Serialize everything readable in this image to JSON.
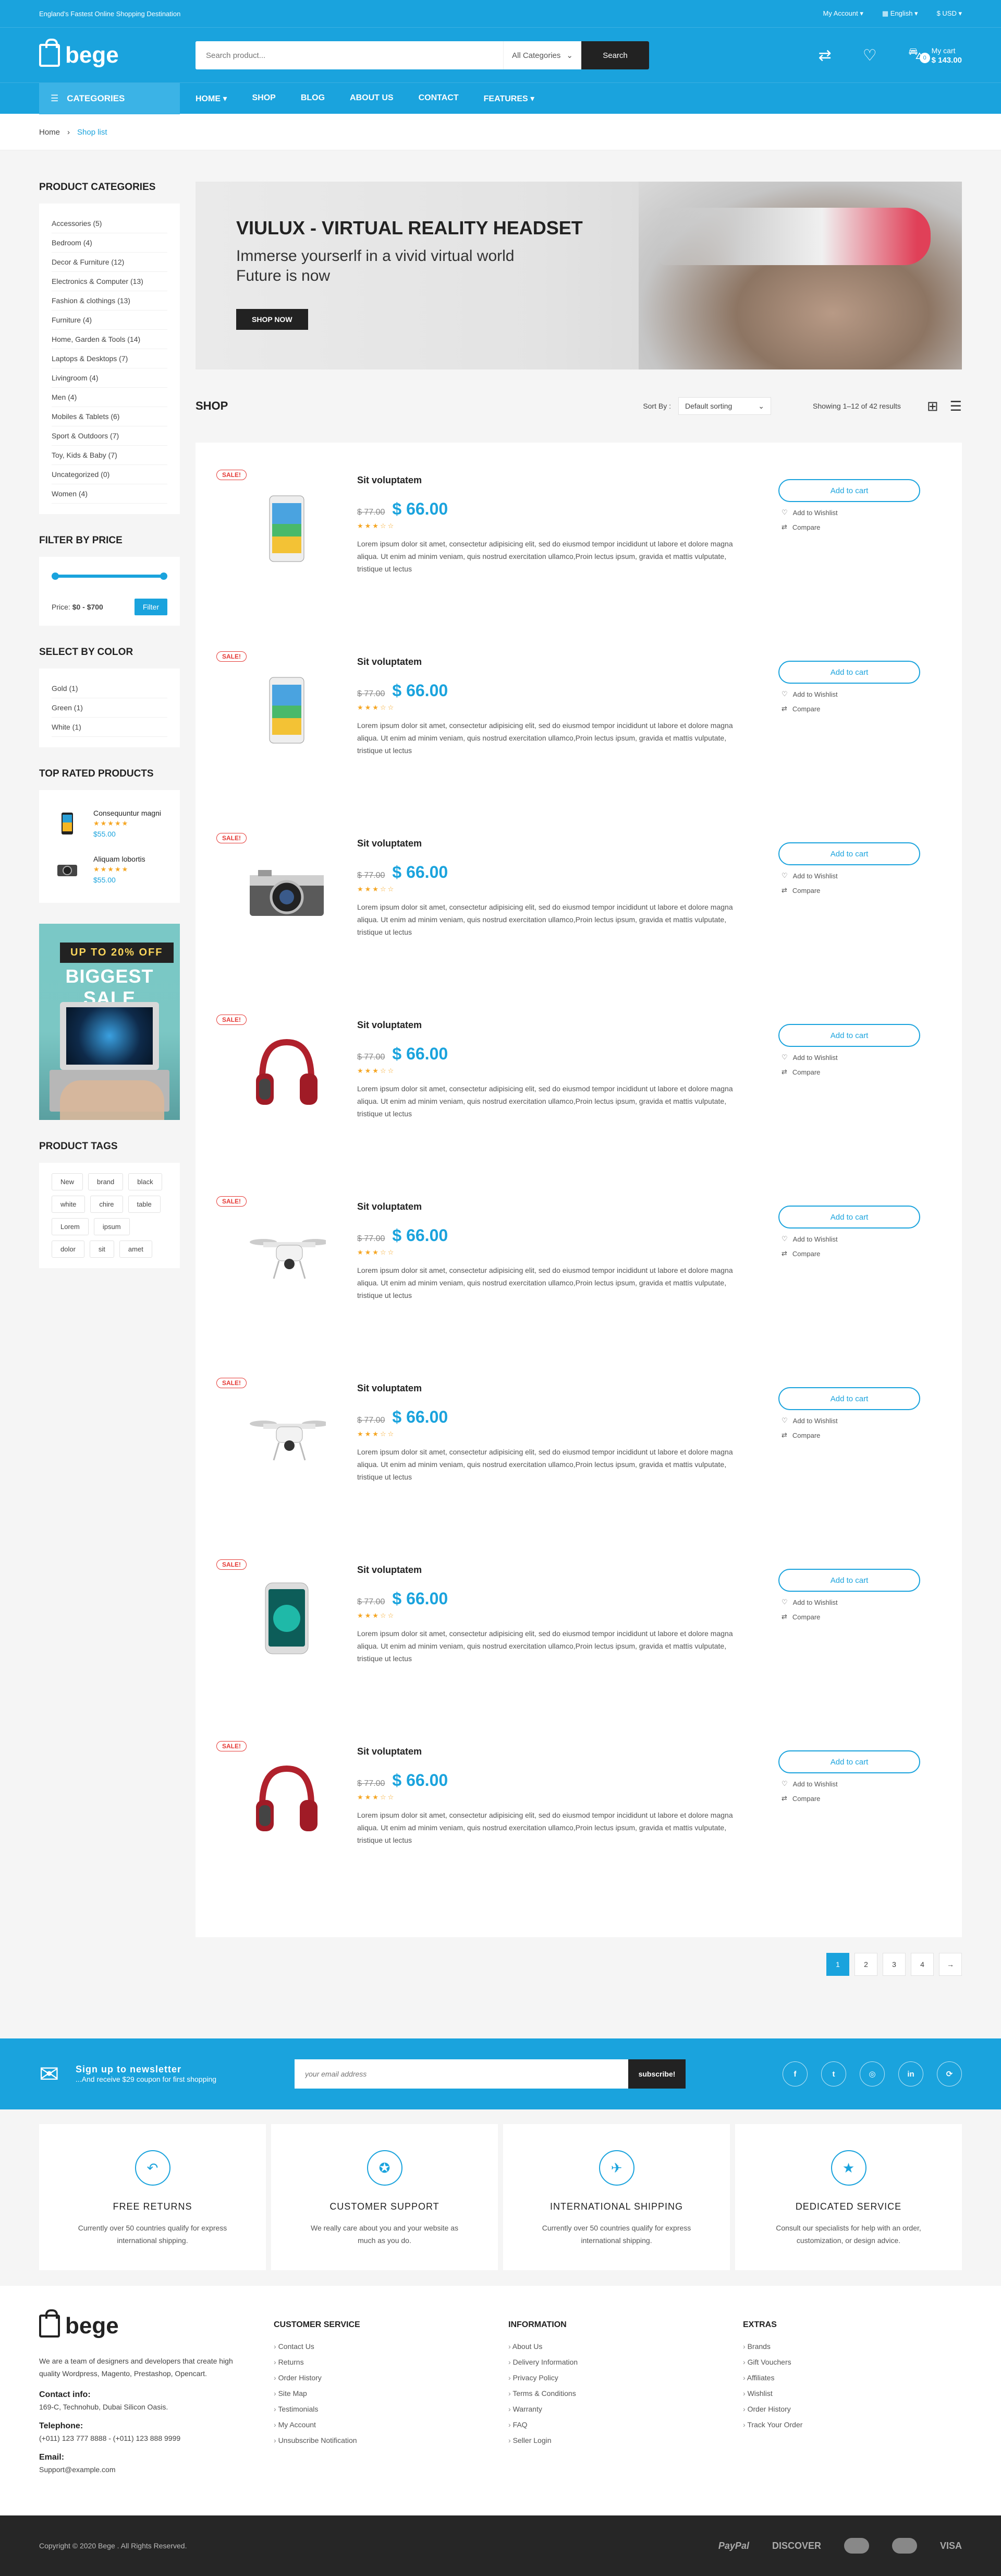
{
  "topbar": {
    "tagline": "England's Fastest Online Shopping Destination",
    "account": "My Account",
    "language": "English",
    "currency": "$ USD"
  },
  "header": {
    "logo": "bege",
    "search_placeholder": "Search product...",
    "search_category": "All Categories",
    "search_button": "Search",
    "cart_label": "My cart",
    "cart_total": "$ 143.00",
    "cart_count": "0"
  },
  "nav": {
    "categories_button": "Categories",
    "items": [
      {
        "label": "Home"
      },
      {
        "label": "Shop"
      },
      {
        "label": "Blog"
      },
      {
        "label": "About Us"
      },
      {
        "label": "Contact"
      },
      {
        "label": "Features"
      }
    ]
  },
  "breadcrumb": {
    "home": "Home",
    "current": "Shop list"
  },
  "sidebar": {
    "categories_title": "Product Categories",
    "categories": [
      "Accessories (5)",
      "Bedroom (4)",
      "Decor & Furniture (12)",
      "Electronics & Computer (13)",
      "Fashion & clothings (13)",
      "Furniture (4)",
      "Home, Garden & Tools (14)",
      "Laptops & Desktops (7)",
      "Livingroom (4)",
      "Men (4)",
      "Mobiles & Tablets (6)",
      "Sport & Outdoors (7)",
      "Toy, Kids & Baby (7)",
      "Uncategorized (0)",
      "Women (4)"
    ],
    "price_title": "Filter by price",
    "price_label": "Price:",
    "price_range": "$0 - $700",
    "filter_button": "Filter",
    "color_title": "Select by color",
    "colors": [
      "Gold (1)",
      "Green (1)",
      "White (1)"
    ],
    "top_rated_title": "Top Rated Products",
    "top_rated": [
      {
        "name": "Consequuntur magni",
        "stars": "★★★★★",
        "price": "$55.00"
      },
      {
        "name": "Aliquam lobortis",
        "stars": "★★★★★",
        "price": "$55.00"
      }
    ],
    "sale_banner_tag": "UP TO 20% OFF",
    "sale_banner_text": "BIGGEST SALE",
    "tags_title": "Product Tags",
    "tags": [
      "New",
      "brand",
      "black",
      "white",
      "chire",
      "table",
      "Lorem",
      "ipsum",
      "dolor",
      "sit",
      "amet"
    ]
  },
  "hero": {
    "title": "VIULUX - VIRTUAL REALITY HEADSET",
    "subtitle": "Immerse yourserlf in a vivid virtual world Future is now",
    "button": "Shop now"
  },
  "toolbar": {
    "title": "Shop",
    "sort_label": "Sort By :",
    "sort_value": "Default sorting",
    "results": "Showing 1–12 of 42 results"
  },
  "product_common": {
    "sale": "SALE!",
    "title": "Sit voluptatem",
    "old_price": "$ 77.00",
    "new_price": "$ 66.00",
    "stars": "★★★☆☆",
    "desc": "Lorem ipsum dolor sit amet, consectetur adipisicing elit, sed do eiusmod tempor incididunt ut labore et dolore magna aliqua. Ut enim ad minim veniam, quis nostrud exercitation ullamco,Proin lectus ipsum, gravida et mattis vulputate, tristique ut lectus",
    "add_to_cart": "Add to cart",
    "wishlist": "Add to Wishlist",
    "compare": "Compare"
  },
  "products": [
    {
      "image": "phone-icon"
    },
    {
      "image": "phone-icon"
    },
    {
      "image": "camera-icon"
    },
    {
      "image": "headphones-icon"
    },
    {
      "image": "drone-icon"
    },
    {
      "image": "drone-icon"
    },
    {
      "image": "iphone-icon"
    },
    {
      "image": "headphones-icon"
    }
  ],
  "pagination": [
    "1",
    "2",
    "3",
    "4",
    "→"
  ],
  "newsletter": {
    "title": "Sign up to newsletter",
    "sub": "...And receive $29 coupon for first shopping",
    "placeholder": "your email address",
    "button": "subscribe!"
  },
  "socials": [
    "f",
    "t",
    "◎",
    "in",
    "⟳"
  ],
  "services": [
    {
      "title": "Free Returns",
      "text": "Currently over 50 countries qualify for express international shipping.",
      "icon": "return-icon"
    },
    {
      "title": "Customer Support",
      "text": "We really care about you and your website as much as you do.",
      "icon": "support-icon"
    },
    {
      "title": "International Shipping",
      "text": "Currently over 50 countries qualify for express international shipping.",
      "icon": "plane-icon"
    },
    {
      "title": "Dedicated Service",
      "text": "Consult our specialists for help with an order, customization, or design advice.",
      "icon": "star-icon"
    }
  ],
  "footer": {
    "about": "We are a team of designers and developers that create high quality Wordpress, Magento, Prestashop, Opencart.",
    "contact_title": "Contact info:",
    "address": "169-C, Technohub, Dubai Silicon Oasis.",
    "telephone_title": "Telephone:",
    "telephone": "(+011) 123 777 8888 - (+011) 123 888 9999",
    "email_title": "Email:",
    "email": "Support@example.com",
    "columns": [
      {
        "title": "Customer Service",
        "items": [
          "Contact Us",
          "Returns",
          "Order History",
          "Site Map",
          "Testimonials",
          "My Account",
          "Unsubscribe Notification"
        ]
      },
      {
        "title": "Information",
        "items": [
          "About Us",
          "Delivery Information",
          "Privacy Policy",
          "Terms & Conditions",
          "Warranty",
          "FAQ",
          "Seller Login"
        ]
      },
      {
        "title": "Extras",
        "items": [
          "Brands",
          "Gift Vouchers",
          "Affiliates",
          "Wishlist",
          "Order History",
          "Track Your Order"
        ]
      }
    ],
    "copyright": "Copyright © 2020 Bege . All Rights Reserved.",
    "payments": [
      "PayPal",
      "DISCOVER",
      "VISA"
    ]
  }
}
